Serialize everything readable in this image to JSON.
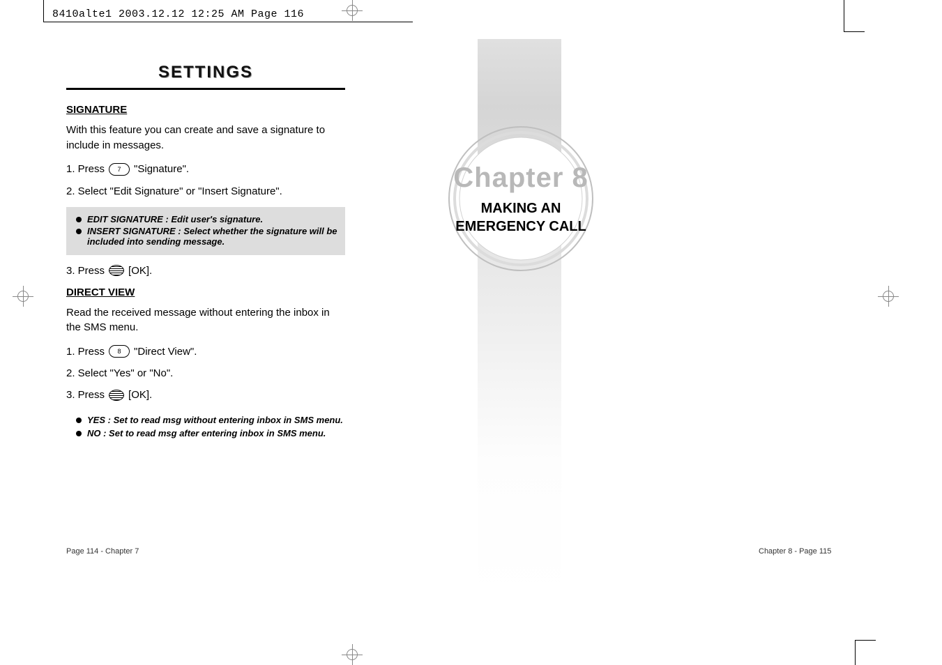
{
  "header": {
    "slug": "8410alte1  2003.12.12  12:25 AM  Page 116"
  },
  "left_page": {
    "title": "SETTINGS",
    "sections": [
      {
        "heading": "SIGNATURE",
        "intro": "With this feature you can create and save a signature to include in messages.",
        "steps": [
          {
            "pre": "1. Press",
            "key": "7",
            "keytype": "oval",
            "post": "\"Signature\"."
          },
          {
            "pre": "2. Select \"Edit Signature\" or \"Insert Signature\".",
            "key": "",
            "keytype": "",
            "post": ""
          }
        ],
        "notebox": [
          "EDIT SIGNATURE : Edit user's signature.",
          "INSERT SIGNATURE : Select whether the signature will be included into sending message."
        ],
        "steps2": [
          {
            "pre": "3. Press",
            "key": "",
            "keytype": "round",
            "post": "[OK]."
          }
        ]
      },
      {
        "heading": "DIRECT VIEW",
        "intro": "Read the received message without entering the inbox in the SMS menu.",
        "steps": [
          {
            "pre": "1. Press",
            "key": "8",
            "keytype": "oval",
            "post": "\"Direct View\"."
          },
          {
            "pre": "2. Select \"Yes\" or \"No\".",
            "key": "",
            "keytype": "",
            "post": ""
          },
          {
            "pre": "3. Press",
            "key": "",
            "keytype": "round",
            "post": "[OK]."
          }
        ],
        "bullets": [
          "YES : Set to read msg without entering inbox in SMS menu.",
          "NO : Set to read msg after entering inbox in SMS menu."
        ]
      }
    ],
    "footer": "Page 114 - Chapter 7"
  },
  "right_page": {
    "chapter_label": "Chapter 8",
    "chapter_title_line1": "MAKING AN",
    "chapter_title_line2": "EMERGENCY CALL",
    "footer": "Chapter 8 - Page 115"
  }
}
